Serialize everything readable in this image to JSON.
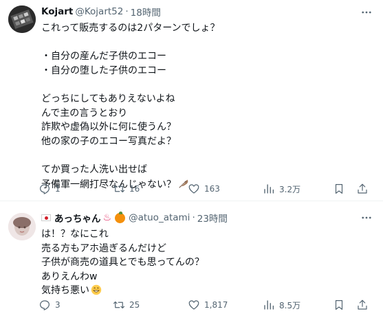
{
  "tweets": [
    {
      "name": "Kojart",
      "handle": "@Kojart52",
      "time": "18時間",
      "lines": [
        "これって販売するのは2パターンでしょ？",
        "",
        "・自分の産んだ子供のエコー",
        "・自分の堕した子供のエコー",
        "",
        "どっちにしてもありえないよね",
        "んで主の言うとおり",
        "詐欺や虚偽以外に何に使うん？",
        "他の家の子のエコー写真だよ？",
        "",
        "てか買った人洗い出せば",
        "予備軍一網打尽なんじゃない？"
      ],
      "trailing_emoji": "feather-emoji",
      "replies": "1",
      "reposts": "16",
      "likes": "163",
      "views": "3.2万"
    },
    {
      "name": "あっちゃん",
      "handle": "@atuo_atami",
      "time": "23時間",
      "name_emojis": [
        "japan-flag-emoji",
        "hot-springs-emoji",
        "tangerine-emoji"
      ],
      "lines": [
        "は！？なにこれ",
        "売る方もアホ過ぎるんだけど",
        "子供が商売の道具とでも思ってんの？",
        "ありえんわw",
        "気持ち悪い"
      ],
      "trailing_emoji": "grinning-face-emoji",
      "replies": "3",
      "reposts": "25",
      "likes": "1,817",
      "views": "8.5万"
    }
  ],
  "colors": {
    "text": "#0f1419",
    "secondary": "#536471",
    "divider": "#eff3f4"
  },
  "icons": [
    "reply-icon",
    "repost-icon",
    "like-icon",
    "views-icon",
    "bookmark-icon",
    "share-icon",
    "more-icon"
  ]
}
